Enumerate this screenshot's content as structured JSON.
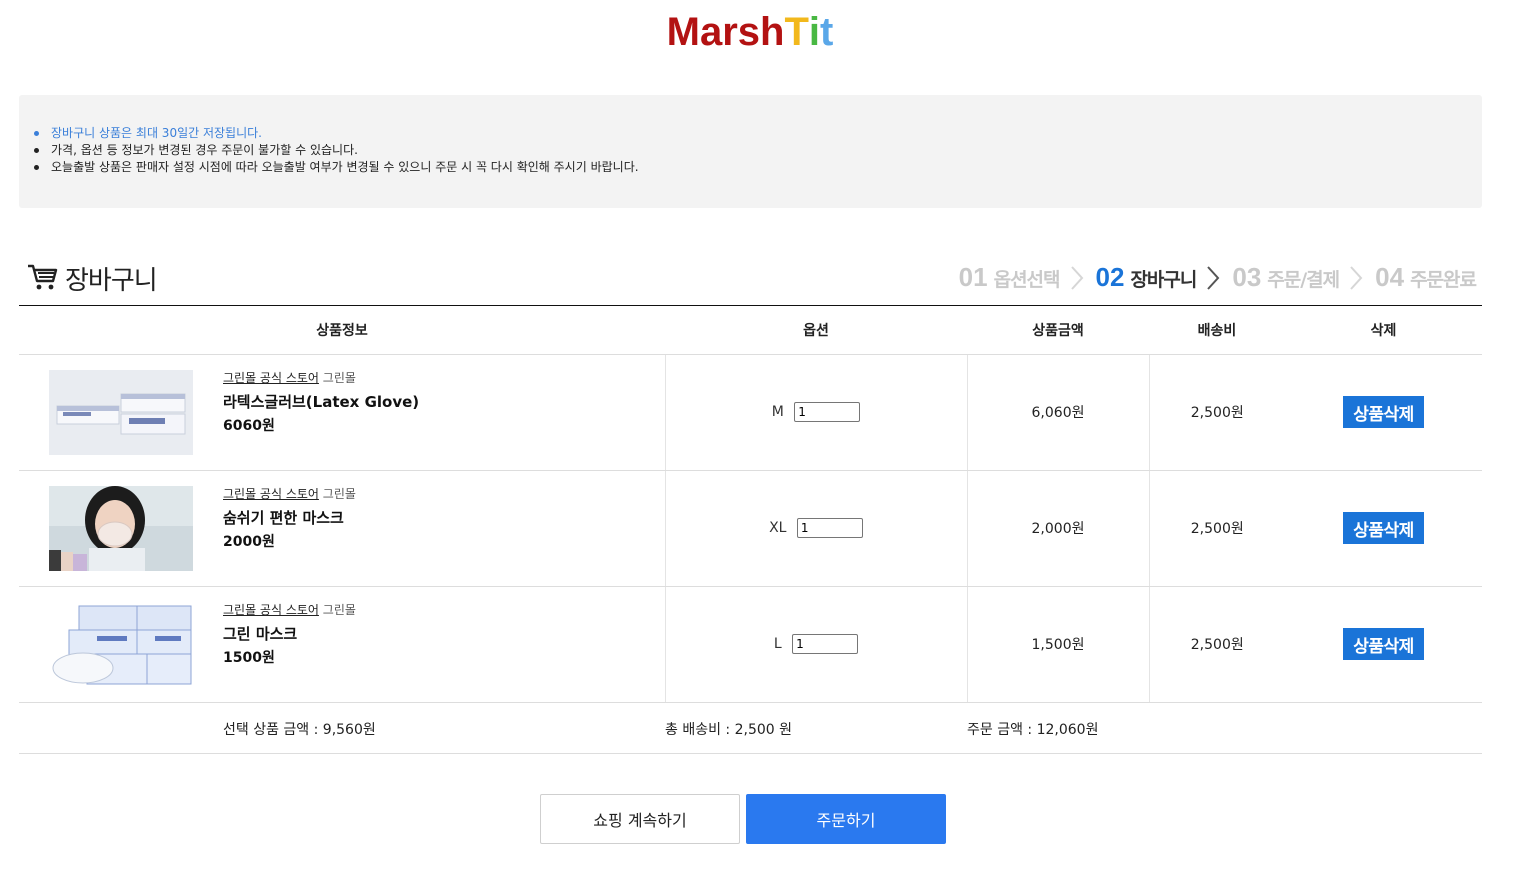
{
  "logo": {
    "letters": [
      {
        "ch": "M",
        "color": "#b31212"
      },
      {
        "ch": "a",
        "color": "#b31212"
      },
      {
        "ch": "r",
        "color": "#b31212"
      },
      {
        "ch": "s",
        "color": "#b31212"
      },
      {
        "ch": "h",
        "color": "#b31212"
      },
      {
        "ch": "T",
        "color": "#f2b81c"
      },
      {
        "ch": "i",
        "color": "#49b843"
      },
      {
        "ch": "t",
        "color": "#5aa7e8"
      }
    ]
  },
  "notice": {
    "items": [
      "장바구니 상품은 최대 30일간 저장됩니다.",
      "가격, 옵션 등 정보가 변경된 경우 주문이 불가할 수 있습니다.",
      "오늘출발 상품은 판매자 설정 시점에 따라 오늘출발 여부가 변경될 수 있으니 주문 시 꼭 다시 확인해 주시기 바랍니다."
    ]
  },
  "cart": {
    "title": "장바구니",
    "icon": "cart-icon"
  },
  "steps": [
    {
      "num": "01",
      "label": "옵션선택",
      "active": false
    },
    {
      "num": "02",
      "label": "장바구니",
      "active": true
    },
    {
      "num": "03",
      "label": "주문/결제",
      "active": false
    },
    {
      "num": "04",
      "label": "주문완료",
      "active": false
    }
  ],
  "table": {
    "headers": {
      "info": "상품정보",
      "option": "옵션",
      "price": "상품금액",
      "shipping": "배송비",
      "delete": "삭제"
    }
  },
  "items": [
    {
      "store": "그린몰 공식 스토어",
      "brand": "그린몰",
      "name": "라텍스글러브(Latex Glove)",
      "price": "6060원",
      "option": "M",
      "qty": "1",
      "amount": "6,060원",
      "shipping": "2,500원",
      "delete_label": "상품삭제",
      "image": "glove-box-image"
    },
    {
      "store": "그린몰 공식 스토어",
      "brand": "그린몰",
      "name": "숨쉬기 편한 마스크",
      "price": "2000원",
      "option": "XL",
      "qty": "1",
      "amount": "2,000원",
      "shipping": "2,500원",
      "delete_label": "상품삭제",
      "image": "mask-model-image"
    },
    {
      "store": "그린몰 공식 스토어",
      "brand": "그린몰",
      "name": "그린 마스크",
      "price": "1500원",
      "option": "L",
      "qty": "1",
      "amount": "1,500원",
      "shipping": "2,500원",
      "delete_label": "상품삭제",
      "image": "mask-boxes-image"
    }
  ],
  "summary": {
    "selected": "선택 상품 금액 : 9,560원",
    "shipping": "총 배송비 : 2,500 원",
    "total": "주문 금액 : 12,060원"
  },
  "buttons": {
    "continue": "쇼핑 계속하기",
    "order": "주문하기"
  },
  "colors": {
    "accent": "#1a74d8",
    "order_button": "#2a79ef",
    "notice_bg": "#f3f3f3"
  }
}
